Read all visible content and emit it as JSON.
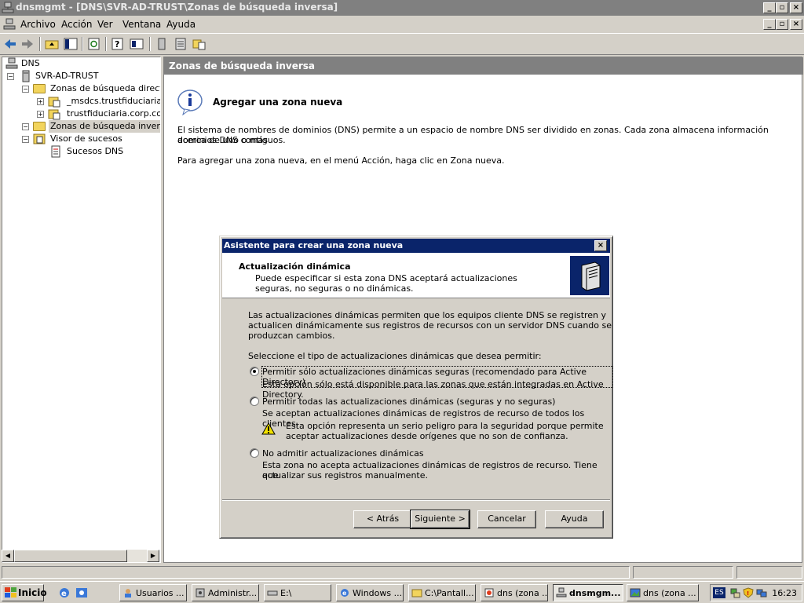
{
  "window": {
    "title": "dnsmgmt - [DNS\\SVR-AD-TRUST\\Zonas de búsqueda inversa]"
  },
  "menu": {
    "items": [
      "Archivo",
      "Acción",
      "Ver",
      "Ventana",
      "Ayuda"
    ]
  },
  "tree": {
    "root": "DNS",
    "server": "SVR-AD-TRUST",
    "forward_zones": "Zonas de búsqueda directa",
    "zone1": "_msdcs.trustfiduciaria.co",
    "zone2": "trustfiduciaria.corp.com",
    "reverse_zones": "Zonas de búsqueda inversa",
    "event_viewer": "Visor de sucesos",
    "dns_events": "Sucesos DNS"
  },
  "content": {
    "header": "Zonas de búsqueda inversa",
    "title": "Agregar una zona nueva",
    "para1_line1": "El sistema de nombres de dominios (DNS) permite a un espacio de nombre DNS ser dividido en zonas. Cada zona almacena información acerca de uno o más",
    "para1_line2": "dominios DNS contiguos.",
    "para2": "Para agregar una zona nueva, en el menú Acción, haga clic en Zona nueva."
  },
  "dialog": {
    "title": "Asistente para crear una zona nueva",
    "header_title": "Actualización dinámica",
    "header_sub": "Puede especificar si esta zona DNS aceptará actualizaciones seguras, no seguras o no dinámicas.",
    "intro_line1": "Las actualizaciones dinámicas permiten que los equipos cliente DNS se registren y",
    "intro_line2": "actualicen dinámicamente sus registros de recursos con un servidor DNS cuando se",
    "intro_line3": "produzcan cambios.",
    "select_label": "Seleccione el tipo de actualizaciones dinámicas que desea permitir:",
    "options": [
      {
        "label": "Permitir sólo actualizaciones dinámicas seguras (recomendado para Active Directory)",
        "desc": "Esta opción sólo está disponible para las zonas que están integradas en Active Directory.",
        "checked": true
      },
      {
        "label": "Permitir todas las actualizaciones dinámicas (seguras y no seguras)",
        "desc": "Se aceptan actualizaciones dinámicas de registros de recurso de todos los clientes.",
        "checked": false
      },
      {
        "label": "No admitir actualizaciones dinámicas",
        "desc_line1": "Esta zona no acepta actualizaciones dinámicas de registros de recurso. Tiene que",
        "desc_line2": "actualizar sus registros manualmente.",
        "checked": false
      }
    ],
    "warning_line1": "Esta opción representa un serio peligro para la seguridad porque permite",
    "warning_line2": "aceptar actualizaciones desde orígenes que no son de confianza.",
    "buttons": {
      "back": "< Atrás",
      "next": "Siguiente >",
      "cancel": "Cancelar",
      "help": "Ayuda"
    }
  },
  "taskbar": {
    "start": "Inicio",
    "tasks": [
      "Usuarios ...",
      "Administr...",
      "E:\\",
      "Windows ...",
      "C:\\Pantall...",
      "dns (zona ...",
      "dnsmgm...",
      "dns (zona ..."
    ],
    "lang": "ES",
    "clock": "16:23"
  },
  "colors": {
    "title_active": "#0a246a",
    "face": "#d4d0c8",
    "shadow": "#808080"
  }
}
